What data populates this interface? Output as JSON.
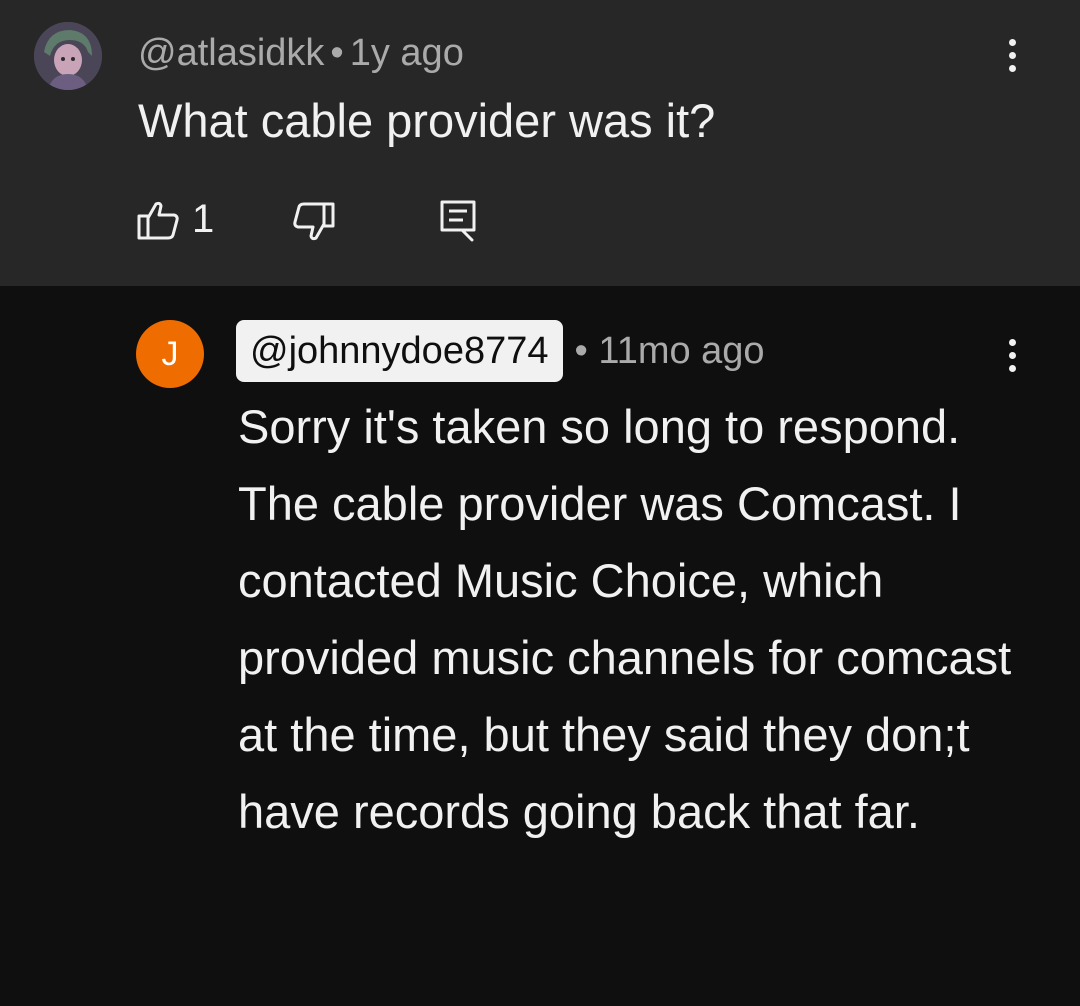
{
  "parent_comment": {
    "handle": "@atlasidkk",
    "separator": "•",
    "time": "1y ago",
    "text": "What cable provider was it?",
    "like_count": "1"
  },
  "reply": {
    "avatar_letter": "J",
    "handle": "@johnnydoe8774",
    "separator": "•",
    "time": "11mo ago",
    "text": "Sorry it's taken so long to respond. The cable provider was Comcast. I contacted Music Choice, which provided music channels for comcast at the time, but they said they don;t have records going back that far."
  },
  "colors": {
    "parent_background": "#272727",
    "page_background": "#0f0f0f",
    "reply_avatar": "#ef6c00",
    "meta_text": "#aaaaaa",
    "body_text": "#f1f1f1"
  },
  "icons": [
    "user-avatar-image",
    "more-vert-icon",
    "thumbs-up-icon",
    "thumbs-down-icon",
    "reply-icon"
  ]
}
